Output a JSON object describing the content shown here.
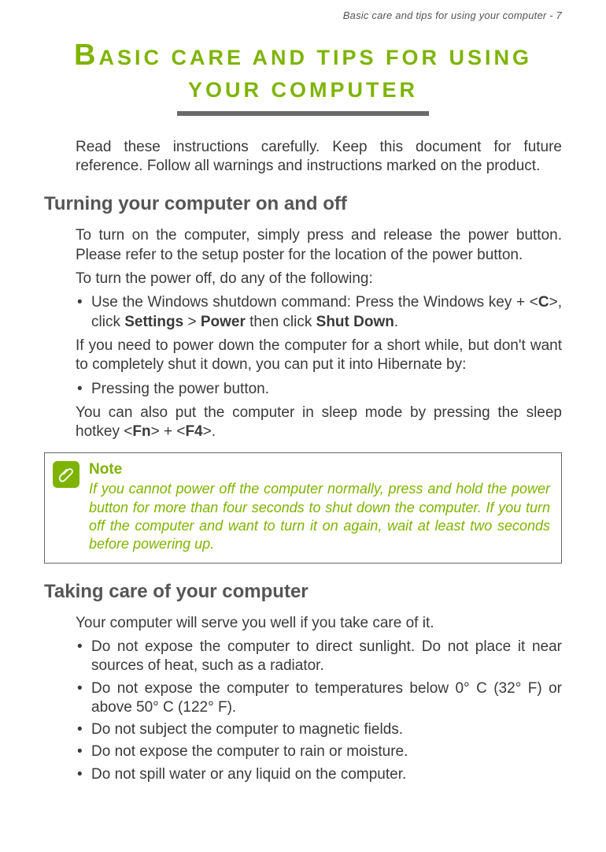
{
  "running_header": "Basic care and tips for using your computer - 7",
  "chapter_title_cap": "B",
  "chapter_title_rest": "ASIC CARE AND TIPS FOR USING YOUR COMPUTER",
  "intro": "Read these instructions carefully. Keep this document for future reference. Follow all warnings and instructions marked on the product.",
  "section1": {
    "heading": "Turning your computer on and off",
    "p1": "To turn on the computer, simply press and release the power button. Please refer to the setup poster for the location of the power button.",
    "p2": "To turn the power off, do any of the following:",
    "li1_pre": "Use the Windows shutdown command: Press the Windows key + <",
    "li1_k1": "C",
    "li1_mid1": ">, click ",
    "li1_b1": "Settings",
    "li1_mid2": " > ",
    "li1_b2": "Power",
    "li1_mid3": " then click ",
    "li1_b3": "Shut Down",
    "li1_post": ".",
    "p3": "If you need to power down the computer for a short while, but don't want to completely shut it down, you can put it into Hibernate by:",
    "li2": "Pressing the power button.",
    "p4_pre": "You can also put the computer in sleep mode by pressing the sleep hotkey <",
    "p4_k1": "Fn",
    "p4_mid": "> + <",
    "p4_k2": "F4",
    "p4_post": ">."
  },
  "note": {
    "title": "Note",
    "body": "If you cannot power off the computer normally, press and hold the power button for more than four seconds to shut down the computer. If you turn off the computer and want to turn it on again, wait at least two seconds before powering up."
  },
  "section2": {
    "heading": "Taking care of your computer",
    "p1": "Your computer will serve you well if you take care of it.",
    "li1": "Do not expose the computer to direct sunlight. Do not place it near sources of heat, such as a radiator.",
    "li2": "Do not expose the computer to temperatures below 0° C (32° F) or above 50° C (122° F).",
    "li3": "Do not subject the computer to magnetic fields.",
    "li4": "Do not expose the computer to rain or moisture.",
    "li5": "Do not spill water or any liquid on the computer."
  }
}
